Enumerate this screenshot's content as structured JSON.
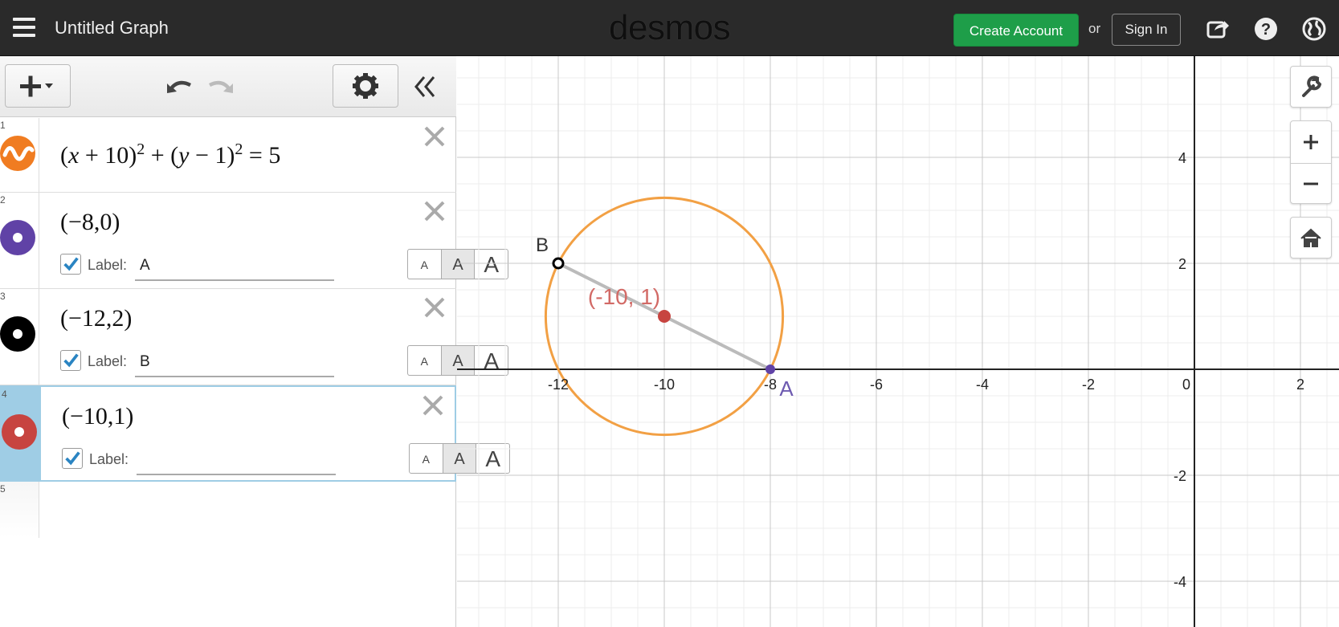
{
  "header": {
    "graph_title": "Untitled Graph",
    "logo": "desmos",
    "create_account": "Create Account",
    "or_text": "or",
    "sign_in": "Sign In",
    "icons": [
      "menu-icon",
      "share-icon",
      "help-icon",
      "language-globe-icon"
    ]
  },
  "toolbar": {
    "icons": [
      "add-expression-icon",
      "undo-icon",
      "redo-icon",
      "settings-gear-icon",
      "collapse-panel-icon"
    ]
  },
  "expressions": [
    {
      "num": "1",
      "latex_html": "(<i>x</i> + 10)<sup style=\"font-size:20px\">2</sup> + (<i>y</i> − 1)<sup style=\"font-size:20px\">2</sup> = 5",
      "color": "#f07c21",
      "type": "curve"
    },
    {
      "num": "2",
      "text": "(−8,0)",
      "color": "#6042a6",
      "type": "point",
      "label_caption": "Label:",
      "label_value": "A",
      "size_options": [
        "A",
        "A",
        "A"
      ]
    },
    {
      "num": "3",
      "text": "(−12,2)",
      "color": "#000000",
      "type": "point",
      "label_caption": "Label:",
      "label_value": "B",
      "size_options": [
        "A",
        "A",
        "A"
      ]
    },
    {
      "num": "4",
      "text": "(−10,1)",
      "color": "#c74440",
      "type": "point",
      "label_caption": "Label:",
      "label_value": "",
      "size_options": [
        "A",
        "A",
        "A"
      ]
    },
    {
      "num": "5"
    }
  ],
  "graph": {
    "x_tick_labels": [
      "-12",
      "-10",
      "-8",
      "-6",
      "-4",
      "-2",
      "0",
      "2"
    ],
    "y_tick_labels": [
      "4",
      "2",
      "-2",
      "-4"
    ],
    "circle": {
      "center": [
        -10,
        1
      ],
      "radius_squared": 5,
      "color": "#f2a044"
    },
    "points": [
      {
        "label": "A",
        "x": -8,
        "y": 0,
        "color": "#6042a6"
      },
      {
        "label": "B",
        "x": -12,
        "y": 2,
        "color": "#000000"
      },
      {
        "label": "(-10, 1)",
        "x": -10,
        "y": 1,
        "color": "#c74440"
      }
    ],
    "segment": {
      "from": [
        -12,
        2
      ],
      "to": [
        -8,
        0
      ],
      "color": "#bbbbbb"
    }
  },
  "right_tools": [
    "wrench-icon",
    "zoom-in-icon",
    "zoom-out-icon",
    "home-icon"
  ]
}
